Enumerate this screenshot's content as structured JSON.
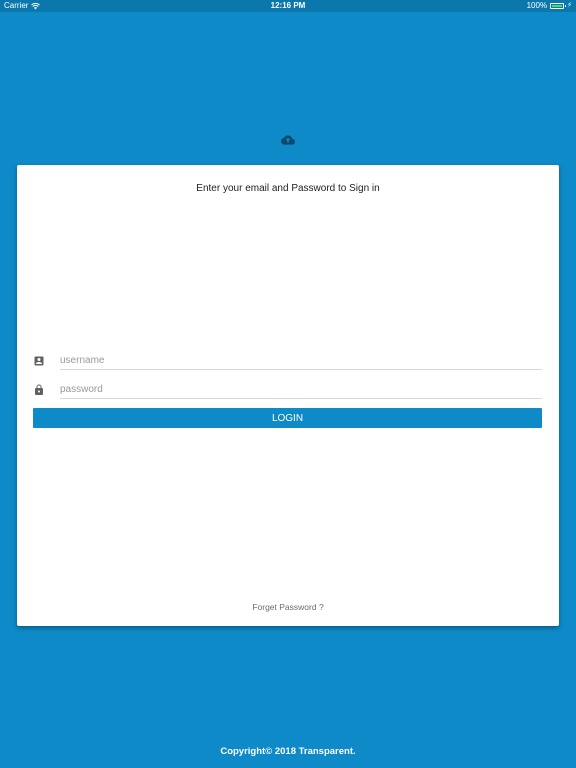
{
  "status_bar": {
    "carrier": "Carrier",
    "time": "12:16 PM",
    "battery_percent": "100%",
    "battery_level": 1.0,
    "battery_color": "#4cd964"
  },
  "logo": {
    "icon": "cloud-upload-icon",
    "color": "#0b4a6e"
  },
  "login_card": {
    "title": "Enter your email and Password to Sign in",
    "username": {
      "icon": "account-box-icon",
      "value": "",
      "placeholder": "username"
    },
    "password": {
      "icon": "lock-icon",
      "value": "",
      "placeholder": "password"
    },
    "login_label": "LOGIN",
    "forgot_label": "Forget Password ?"
  },
  "footer": {
    "copyright": "Copyright© 2018 Transparent."
  },
  "colors": {
    "background": "#0d8ac7",
    "status_bar": "#0b78ad",
    "card": "#ffffff",
    "button": "#0d8ac7"
  }
}
